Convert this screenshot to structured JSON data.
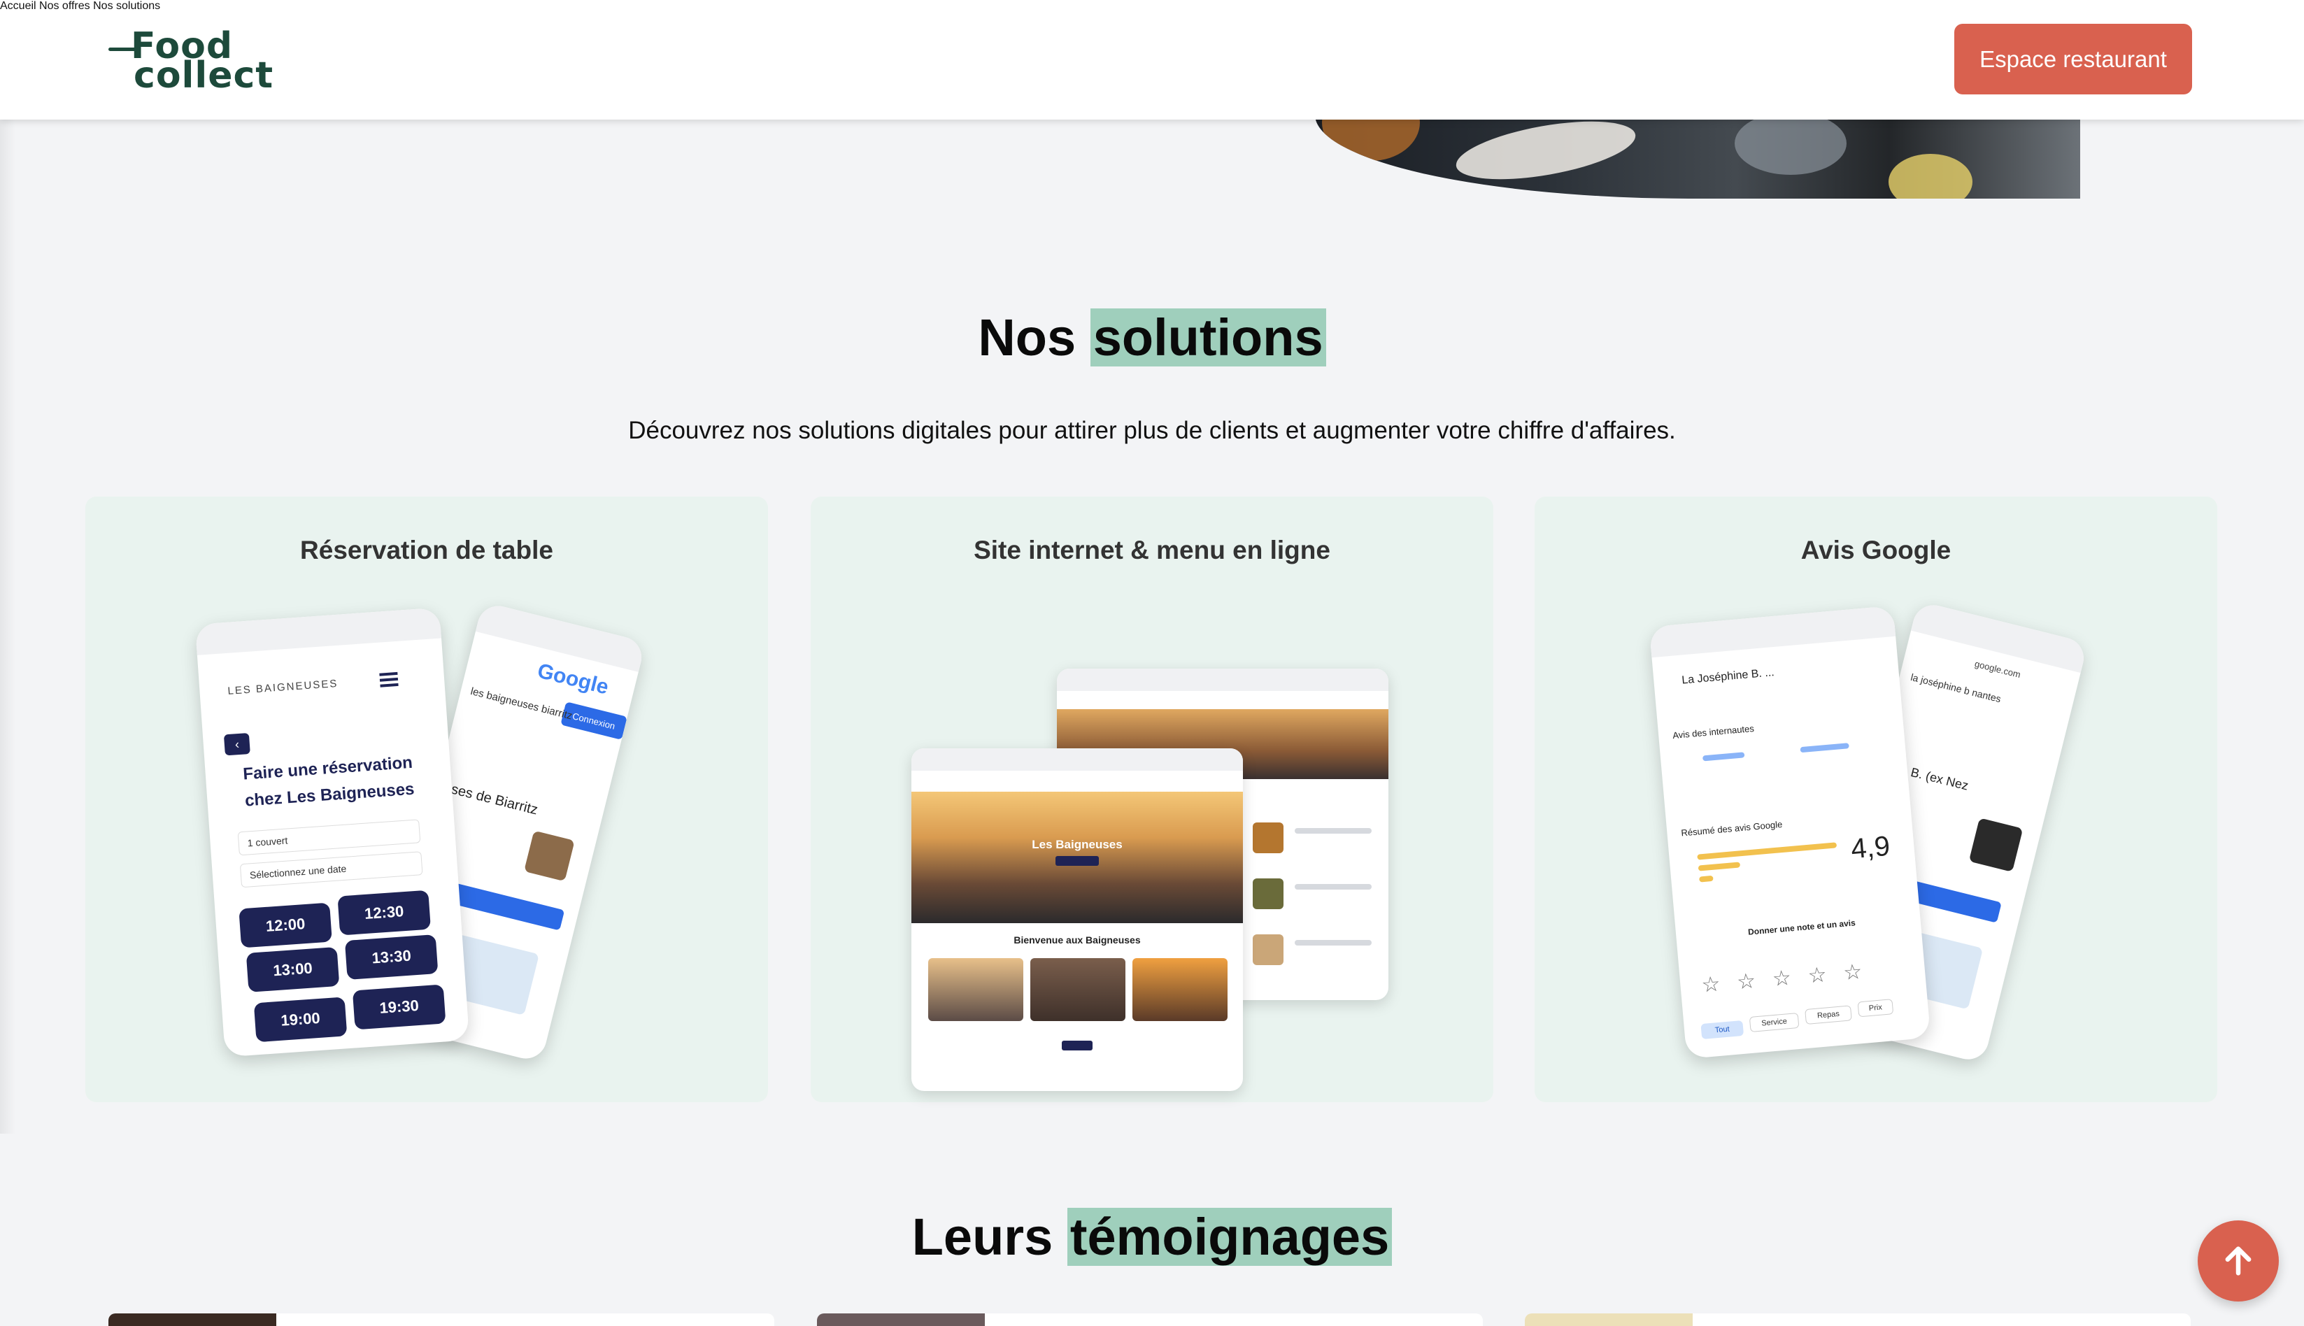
{
  "header": {
    "logo_line1": "Food",
    "logo_line2": "collect",
    "nav": [
      "Accueil",
      "Nos offres",
      "Nos solutions"
    ],
    "cta": "Espace restaurant"
  },
  "solutions": {
    "title_plain": "Nos",
    "title_highlight": "solutions",
    "subtitle": "Découvrez nos solutions digitales pour attirer plus de clients et augmenter votre chiffre d'affaires.",
    "cards": [
      {
        "title": "Réservation de table",
        "mock": {
          "brand": "LES BAIGNEUSES",
          "heading": "Faire une réservation chez Les Baigneuses",
          "field1": "1 couvert",
          "field2": "Sélectionnez une date",
          "times": [
            "12:00",
            "12:30",
            "13:00",
            "13:30",
            "19:00",
            "19:30"
          ],
          "google": "Google",
          "search": "les baigneuses biarritz",
          "connexion": "Connexion",
          "place": "uses de Biarritz"
        }
      },
      {
        "title": "Site internet & menu en ligne",
        "mock": {
          "hero_text": "Les Baigneuses",
          "welcome": "Bienvenue aux Baigneuses"
        }
      },
      {
        "title": "Avis Google",
        "mock": {
          "place": "La Joséphine B. ...",
          "section": "Avis des internautes",
          "summary": "Résumé des avis Google",
          "rating": "4,9",
          "give": "Donner une note et un avis",
          "chips": [
            "Tout",
            "Service",
            "Repas",
            "Prix"
          ],
          "url": "google.com",
          "search": "la joséphine b nantes",
          "place2": "hine B. (ex Nez"
        }
      }
    ]
  },
  "testimonials": {
    "title_plain": "Leurs",
    "title_highlight": "témoignages"
  },
  "colors": {
    "brand_green": "#1d4a3b",
    "accent": "#d9614f",
    "highlight": "#9fcfbc",
    "card_bg": "#e9f3ef",
    "navy": "#1e2355"
  },
  "icons": {
    "back_to_top": "arrow-up-icon"
  }
}
